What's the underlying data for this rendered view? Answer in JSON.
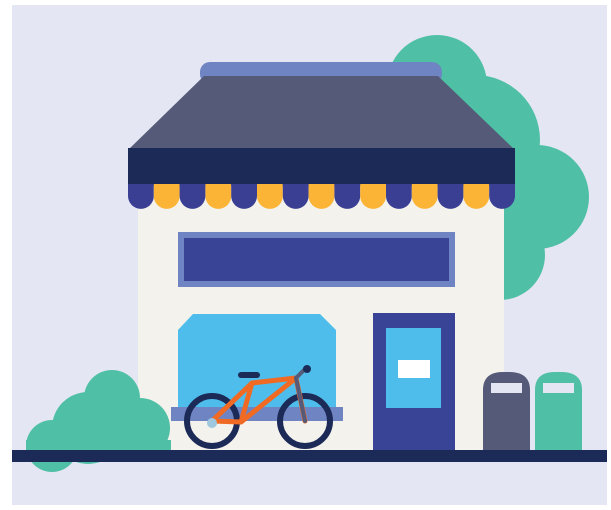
{
  "colors": {
    "page_background": "#ffffff",
    "sky": "#e4e6f3",
    "tree": "#4fc0a5",
    "roof": "#545a77",
    "roof_trim": "#6f84c2",
    "awning_band": "#1c2a57",
    "awning_scallop_dark": "#3a3f94",
    "awning_scallop_yellow": "#fbb435",
    "wall": "#f3f2ec",
    "signboard_frame": "#6f84c2",
    "signboard_panel": "#3a4496",
    "window_glass": "#4ebdeb",
    "window_sill": "#6f84c2",
    "door_frame": "#3a4496",
    "door_glass": "#4ebdeb",
    "door_sign": "#ffffff",
    "bin_dark": "#545a77",
    "bin_green": "#4fc0a5",
    "ground": "#1c2a57",
    "bike_frame": "#f06a24",
    "bike_wheel": "#1c2a57",
    "bike_hub": "#9fc7dd"
  },
  "icons": {
    "scene": "storefront-illustration",
    "tree": "tree-icon",
    "bush": "bush-icon",
    "bicycle": "bicycle-icon",
    "door": "door-icon",
    "bin": "trash-bin-icon"
  }
}
